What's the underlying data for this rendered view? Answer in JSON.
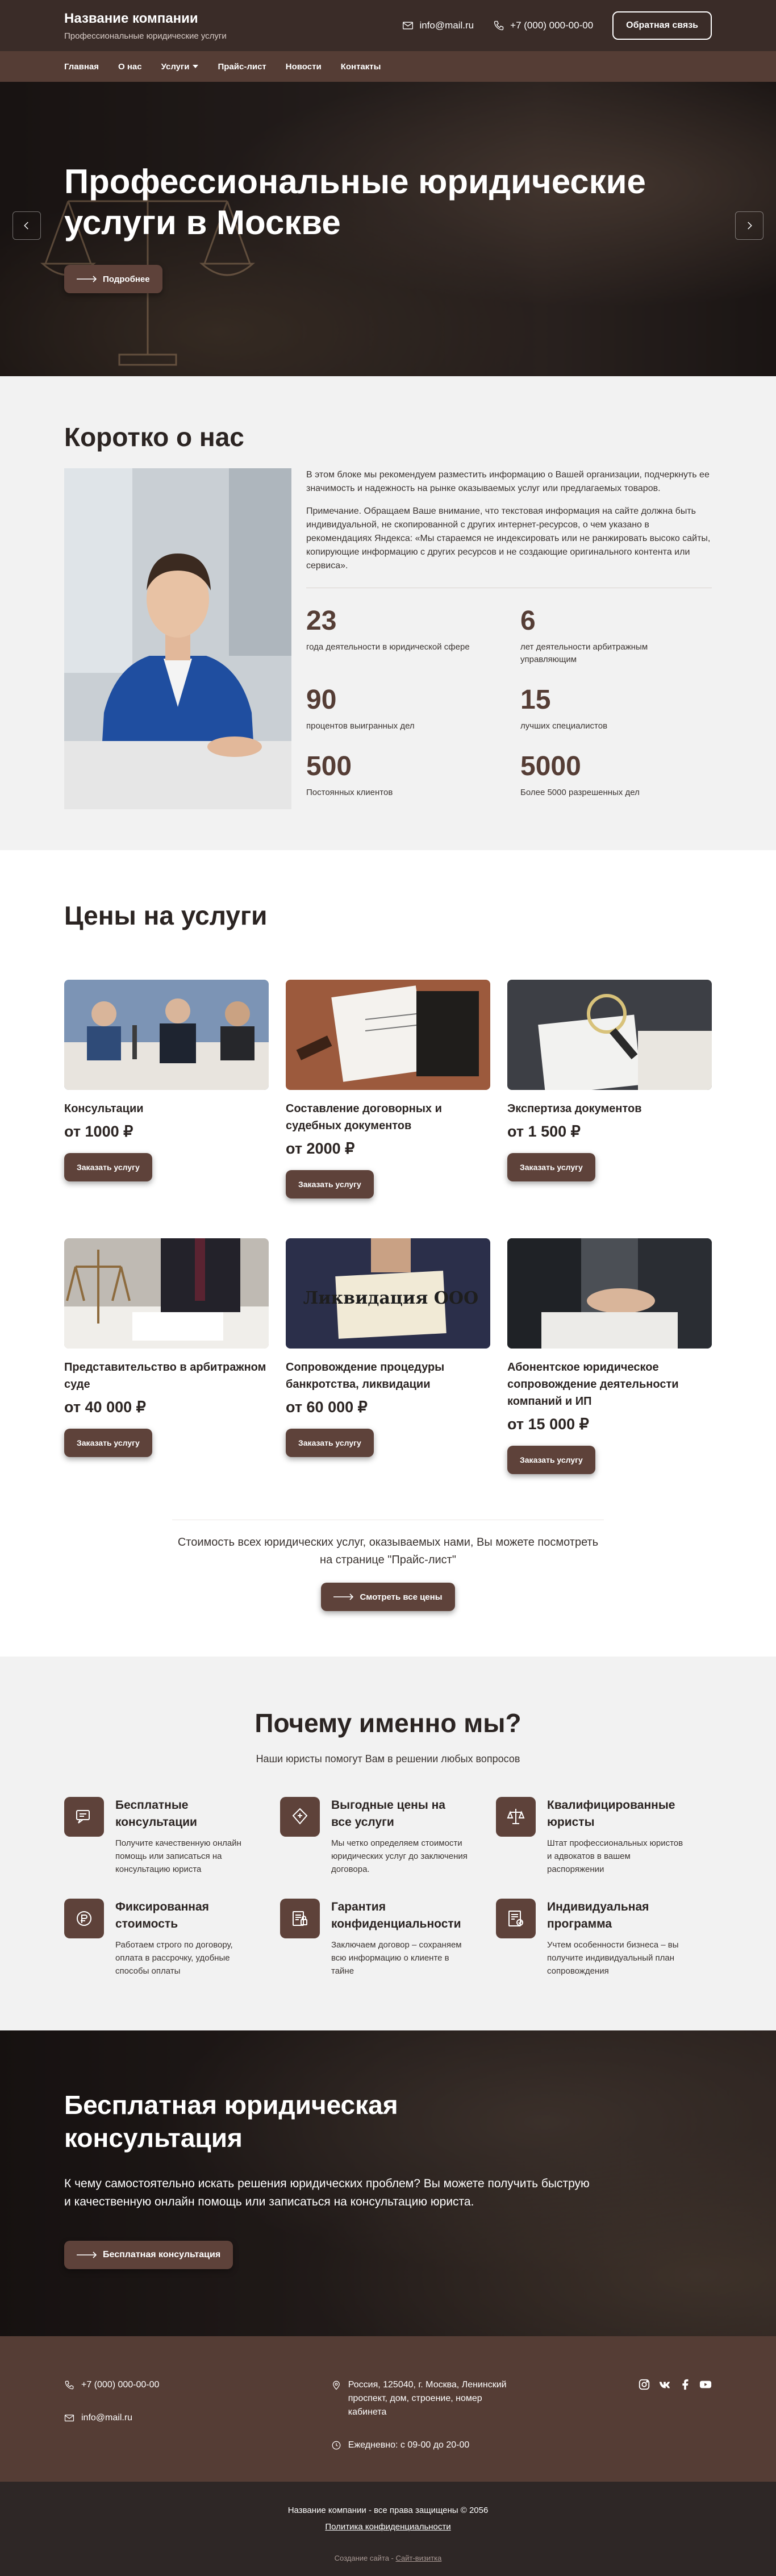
{
  "header": {
    "company_name": "Название компании",
    "company_tagline": "Профессиональные юридические услуги",
    "email": "info@mail.ru",
    "phone": "+7 (000) 000-00-00",
    "callback_button": "Обратная связь"
  },
  "nav": {
    "items": [
      {
        "label": "Главная"
      },
      {
        "label": "О нас"
      },
      {
        "label": "Услуги"
      },
      {
        "label": "Прайс-лист"
      },
      {
        "label": "Новости"
      },
      {
        "label": "Контакты"
      }
    ]
  },
  "hero": {
    "title": "Профессиональные юридические услуги в Москве",
    "button": "Подробнее"
  },
  "about": {
    "title": "Коротко о нас",
    "paragraph1": "В этом блоке мы рекомендуем разместить информацию о Вашей организации, подчеркнуть ее значимость и надежность на рынке оказываемых услуг или предлагаемых товаров.",
    "paragraph2": "Примечание. Обращаем Ваше внимание, что текстовая информация на сайте должна быть индивидуальной, не скопированной с других интернет-ресурсов, о чем указано в рекомендациях Яндекса: «Мы стараемся не индексировать или не ранжировать высоко сайты, копирующие информацию с других ресурсов и не создающие оригинального контента или сервиса».",
    "stats": [
      {
        "value": "23",
        "label": "года деятельности в юридической сфере"
      },
      {
        "value": "6",
        "label": "лет деятельности арбитражным управляющим"
      },
      {
        "value": "90",
        "label": "процентов выигранных дел"
      },
      {
        "value": "15",
        "label": "лучших специалистов"
      },
      {
        "value": "500",
        "label": "Постоянных клиентов"
      },
      {
        "value": "5000",
        "label": "Более 5000 разрешенных дел"
      }
    ]
  },
  "prices": {
    "title": "Цены на услуги",
    "order_label": "Заказать услугу",
    "cards": [
      {
        "title": "Консультации",
        "price": "от 1000 ₽",
        "image_text": ""
      },
      {
        "title": "Составление договорных и судебных документов",
        "price": "от 2000 ₽",
        "image_text": ""
      },
      {
        "title": "Экспертиза документов",
        "price": "от 1 500 ₽",
        "image_text": ""
      },
      {
        "title": "Представительство в арбитражном суде",
        "price": "от 40 000 ₽",
        "image_text": ""
      },
      {
        "title": "Сопровождение процедуры банкротства, ликвидации",
        "price": "от 60 000 ₽",
        "image_text": "Ликвидация ООО"
      },
      {
        "title": "Абонентское юридическое сопровождение деятельности компаний и ИП",
        "price": "от 15 000 ₽",
        "image_text": ""
      }
    ],
    "note": "Стоимость всех юридических услуг, оказываемых нами, Вы можете посмотреть на странице \"Прайс-лист\"",
    "all_prices_button": "Смотреть все цены"
  },
  "why": {
    "title": "Почему именно мы?",
    "subtitle": "Наши юристы помогут Вам в решении любых вопросов",
    "items": [
      {
        "icon": "consultation-icon",
        "title": "Бесплатные консультации",
        "text": "Получите качественную онлайн помощь или записаться на консультацию юриста"
      },
      {
        "icon": "price-icon",
        "title": "Выгодные цены на все услуги",
        "text": "Мы четко определяем стоимости юридических услуг до заключения договора."
      },
      {
        "icon": "lawyers-icon",
        "title": "Квалифицированные юристы",
        "text": "Штат профессиональных юристов и адвокатов в вашем распоряжении"
      },
      {
        "icon": "fixed-cost-icon",
        "title": "Фиксированная стоимость",
        "text": "Работаем строго по договору, оплата в рассрочку, удобные способы оплаты"
      },
      {
        "icon": "privacy-icon",
        "title": "Гарантия конфиденциальности",
        "text": "Заключаем договор – сохраняем всю информацию о клиенте в тайне"
      },
      {
        "icon": "individual-program-icon",
        "title": "Индивидуальная программа",
        "text": "Учтем особенности бизнеса – вы получите индивидуальный план сопровождения"
      }
    ]
  },
  "cta": {
    "title": "Бесплатная юридическая консультация",
    "text": "К чему самостоятельно искать решения юридических проблем? Вы можете получить быструю и качественную онлайн помощь или записаться на консультацию юриста.",
    "button": "Бесплатная консультация"
  },
  "footer": {
    "phone": "+7 (000) 000-00-00",
    "email": "info@mail.ru",
    "address": "Россия, 125040, г. Москва, Ленинский проспект, дом, строение, номер кабинета",
    "hours": "Ежедневно: с 09-00 до 20-00",
    "socials": [
      "instagram-icon",
      "vk-icon",
      "facebook-icon",
      "youtube-icon"
    ],
    "copyright": "Название компании - все права защищены © 2056",
    "privacy": "Политика конфиденциальности",
    "dev_prefix": "Создание сайта - ",
    "dev_link": "Сайт-визитка"
  },
  "colors": {
    "brand_dark": "#3a2c28",
    "brand": "#553d35",
    "button": "#5e423a",
    "footer_bottom": "#2e2726"
  }
}
